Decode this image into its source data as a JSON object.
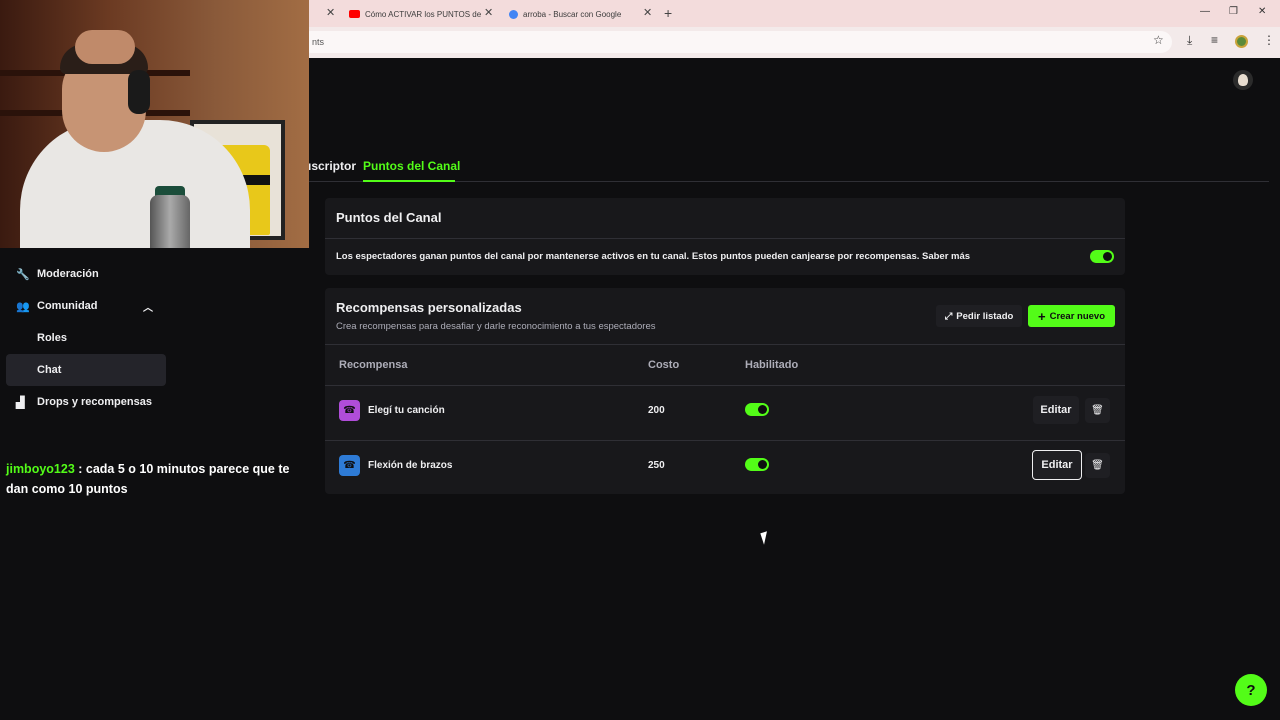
{
  "browser": {
    "tabs": [
      {
        "title": "",
        "favicon_color": "#000000"
      },
      {
        "title": "Cómo ACTIVAR los PUNTOS de",
        "favicon_color": "#ff0000"
      },
      {
        "title": "arroba - Buscar con Google",
        "favicon_color": "#4285f4"
      }
    ],
    "address_text": "nts",
    "icons": [
      "star-icon",
      "download-icon",
      "media-icon",
      "profile-icon",
      "menu-icon"
    ]
  },
  "page_tabs": [
    {
      "label": "uscriptor",
      "active": false
    },
    {
      "label": "Puntos del Canal",
      "active": true
    }
  ],
  "sidebar": {
    "items": [
      {
        "label": "Moderación",
        "icon": "wrench-icon"
      },
      {
        "label": "Comunidad",
        "icon": "community-icon"
      },
      {
        "label": "Roles",
        "icon": ""
      },
      {
        "label": "Chat",
        "icon": "",
        "active": true
      },
      {
        "label": "Drops y recompensas",
        "icon": "chart-icon"
      }
    ]
  },
  "chat_overlay": {
    "username": "jimboyo123",
    "message": " : cada 5 o 10 minutos parece que te dan como 10 puntos"
  },
  "channel_points": {
    "title": "Puntos del Canal",
    "description": "Los espectadores ganan puntos del canal por mantenerse activos en tu canal. Estos puntos pueden canjearse por recompensas. Saber más",
    "enabled": true
  },
  "rewards": {
    "title": "Recompensas personalizadas",
    "subtitle": "Crea recompensas para desafiar y darle reconocimiento a tus espectadores",
    "request_list_label": "Pedir listado",
    "create_label": "Crear nuevo",
    "columns": {
      "reward": "Recompensa",
      "cost": "Costo",
      "enabled": "Habilitado"
    },
    "rows": [
      {
        "name": "Elegí tu canción",
        "cost": "200",
        "enabled": true,
        "icon_color": "#b04dd9",
        "edit_label": "Editar"
      },
      {
        "name": "Flexión de brazos",
        "cost": "250",
        "enabled": true,
        "icon_color": "#2e7bd6",
        "edit_label": "Editar"
      }
    ]
  },
  "colors": {
    "accent": "#53fc18",
    "background": "#0e0e10",
    "panel": "#18181b"
  }
}
